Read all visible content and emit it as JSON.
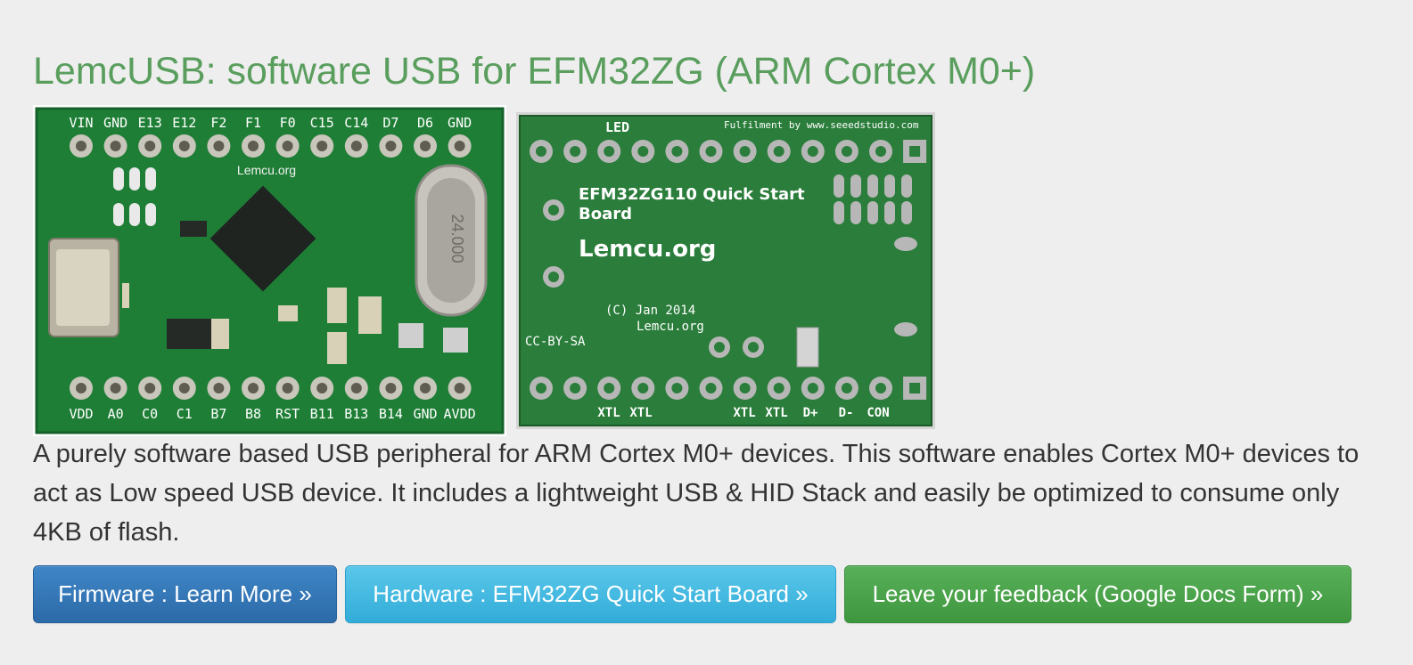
{
  "page": {
    "title": "LemcUSB: software USB for EFM32ZG (ARM Cortex M0+)",
    "description": "A purely software based USB peripheral for ARM Cortex M0+ devices. This software enables Cortex M0+ devices to act as Low speed USB device. It includes a lightweight USB & HID Stack and easily be optimized to consume only 4KB of flash."
  },
  "images": {
    "photo": {
      "top_pins": [
        "VIN",
        "GND",
        "E13",
        "E12",
        "F2",
        "F1",
        "F0",
        "C15",
        "C14",
        "D7",
        "D6",
        "GND"
      ],
      "bottom_pins": [
        "VDD",
        "A0",
        "C0",
        "C1",
        "B7",
        "B8",
        "RST",
        "B11",
        "B13",
        "B14",
        "GND",
        "AVDD"
      ],
      "silk_url": "Lemcu.org",
      "crystal_label": "24.000"
    },
    "render": {
      "led_label": "LED",
      "fulfilment": "Fulfilment by www.seeedstudio.com",
      "board_name_line1": "EFM32ZG110 Quick Start",
      "board_name_line2": "Board",
      "big_url": "Lemcu.org",
      "copyright": "(C) Jan 2014",
      "copyright_url": "Lemcu.org",
      "license": "CC-BY-SA",
      "bottom_labels": [
        "XTL",
        "XTL",
        "XTL",
        "XTL",
        "D+",
        "D-",
        "CON"
      ]
    }
  },
  "buttons": {
    "firmware": "Firmware : Learn More »",
    "hardware": "Hardware : EFM32ZG Quick Start Board »",
    "feedback": "Leave your feedback (Google Docs Form) »"
  },
  "colors": {
    "title": "#5a9e5e",
    "firmware_button": "#337ab7",
    "hardware_button": "#5bc0de",
    "feedback_button": "#4cae4c",
    "pcb_green": "#1f7a3a"
  }
}
